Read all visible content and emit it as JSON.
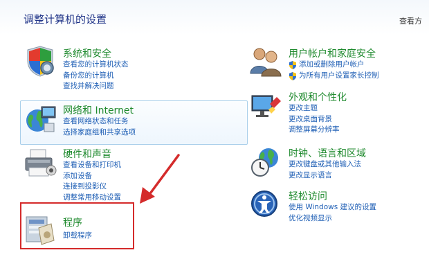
{
  "header": {
    "title": "调整计算机的设置",
    "view_by": "查看方"
  },
  "left": [
    {
      "title": "系统和安全",
      "links": [
        "查看您的计算机状态",
        "备份您的计算机",
        "查找并解决问题"
      ]
    },
    {
      "title": "网络和 Internet",
      "links": [
        "查看网络状态和任务",
        "选择家庭组和共享选项"
      ]
    },
    {
      "title": "硬件和声音",
      "links": [
        "查看设备和打印机",
        "添加设备",
        "连接到投影仪",
        "调整常用移动设置"
      ]
    },
    {
      "title": "程序",
      "links": [
        "卸载程序"
      ]
    }
  ],
  "right": [
    {
      "title": "用户帐户和家庭安全",
      "links": [
        "添加或删除用户帐户",
        "为所有用户设置家长控制"
      ]
    },
    {
      "title": "外观和个性化",
      "links": [
        "更改主题",
        "更改桌面背景",
        "调整屏幕分辨率"
      ]
    },
    {
      "title": "时钟、语言和区域",
      "links": [
        "更改键盘或其他输入法",
        "更改显示语言"
      ]
    },
    {
      "title": "轻松访问",
      "links": [
        "使用 Windows 建议的设置",
        "优化视频显示"
      ]
    }
  ],
  "colors": {
    "category_title": "#1f8a2e",
    "link": "#1f5fb5",
    "annotation": "#d42b2b"
  }
}
